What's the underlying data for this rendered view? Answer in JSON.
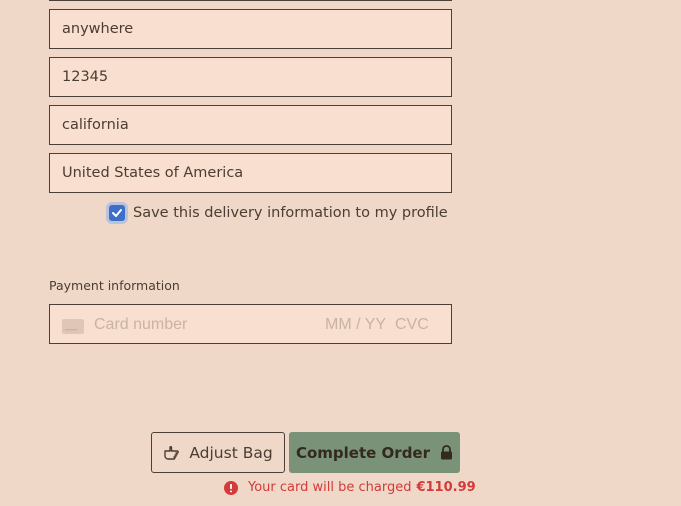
{
  "delivery": {
    "city": "anywhere",
    "postal_code": "12345",
    "state": "california",
    "country": "United States of America",
    "save_checkbox": {
      "checked": true,
      "label": "Save this delivery information to my profile"
    }
  },
  "payment": {
    "section_label": "Payment information",
    "card_number_placeholder": "Card number",
    "expiry_placeholder": "MM / YY",
    "cvc_placeholder": "CVC"
  },
  "actions": {
    "adjust_bag_label": "Adjust Bag",
    "complete_order_label": "Complete Order"
  },
  "charge_notice": {
    "text": "Your card will be charged",
    "amount": "€110.99"
  },
  "colors": {
    "background": "#efd8c8",
    "field_background": "#f8dfcf",
    "primary_button": "#7a9277",
    "checkbox": "#3e6fc8",
    "error": "#d43a3a"
  },
  "icons": {
    "card": "credit-card-icon",
    "adjust": "pointing-hand-icon",
    "lock": "lock-icon",
    "alert": "alert-circle-icon",
    "check": "checkmark-icon"
  }
}
